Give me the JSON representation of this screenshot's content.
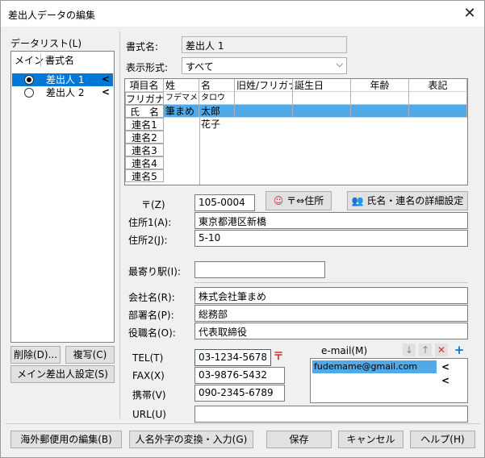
{
  "window": {
    "title": "差出人データの編集",
    "close": "✕"
  },
  "datalist": {
    "label": "データリスト(L)",
    "col_main": "メイン",
    "col_name": "書式名",
    "items": [
      {
        "label": "差出人 1",
        "selected": true
      },
      {
        "label": "差出人 2",
        "selected": false
      }
    ],
    "arrow": "<"
  },
  "left_buttons": {
    "delete": "削除(D)...",
    "copy": "複写(C)",
    "main_setting": "メイン差出人設定(S)"
  },
  "form": {
    "format_name_label": "書式名:",
    "format_name_value": "差出人 1",
    "display_label": "表示形式:",
    "display_value": "すべて",
    "grid": {
      "headers": [
        "項目名",
        "姓",
        "名",
        "旧姓/フリガナ",
        "誕生日",
        "年齢",
        "表記"
      ],
      "rows": [
        {
          "head": "フリガナ",
          "sei": "フデマメ",
          "mei": "タロウ"
        },
        {
          "head": "氏　名",
          "sei": "筆まめ",
          "mei": "太郎"
        },
        {
          "head": "連名1",
          "sei": "",
          "mei": "花子"
        },
        {
          "head": "連名2",
          "sei": "",
          "mei": ""
        },
        {
          "head": "連名3",
          "sei": "",
          "mei": ""
        },
        {
          "head": "連名4",
          "sei": "",
          "mei": ""
        },
        {
          "head": "連名5",
          "sei": "",
          "mei": ""
        }
      ]
    },
    "zip_label": "〒(Z)",
    "zip_value": "105-0004",
    "zip_addr_button": "〒⇔住所",
    "detail_button": "氏名・連名の詳細設定",
    "addr1_label": "住所1(A):",
    "addr1_value": "東京都港区新橋",
    "addr2_label": "住所2(J):",
    "addr2_value": "5-10",
    "station_label": "最寄り駅(I):",
    "station_value": "",
    "company_label": "会社名(R):",
    "company_value": "株式会社筆まめ",
    "dept_label": "部署名(P):",
    "dept_value": "総務部",
    "title_label": "役職名(O):",
    "title_value": "代表取締役",
    "tel_label": "TEL(T)",
    "tel_value": "03-1234-5678",
    "fax_label": "FAX(X)",
    "fax_value": "03-9876-5432",
    "mobile_label": "携帯(V)",
    "mobile_value": "090-2345-6789",
    "url_label": "URL(U)",
    "url_value": "",
    "email_label": "e-mail(M)",
    "emails": [
      "fudemame@gmail.com"
    ]
  },
  "bottom_buttons": {
    "overseas": "海外郵便用の編集(B)",
    "gaiji": "人名外字の変換・入力(G)",
    "save": "保存",
    "cancel": "キャンセル",
    "help": "ヘルプ(H)"
  },
  "colors": {
    "selection": "#0078d7",
    "grid_selection": "#51aae8",
    "accent_red": "#d32f2f"
  }
}
